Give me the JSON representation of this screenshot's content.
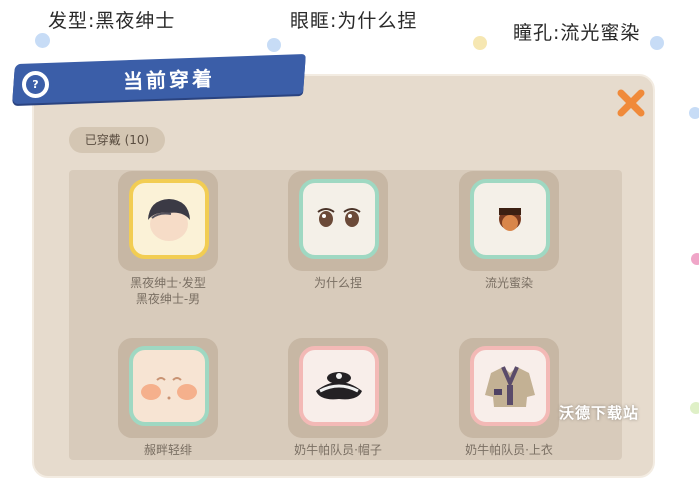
{
  "header_labels": {
    "hair": "发型:黑夜绅士",
    "eyes": "眼眶:为什么捏",
    "pupil": "瞳孔:流光蜜染"
  },
  "panel": {
    "title": "当前穿着",
    "worn_count_label": "已穿戴 (10)"
  },
  "items": [
    {
      "label": "黑夜绅士·发型\n黑夜绅士-男",
      "icon": "hair-head-icon",
      "frame_color": "#f2cd53"
    },
    {
      "label": "为什么捏",
      "icon": "eyes-icon",
      "frame_color": "#9fd8c2"
    },
    {
      "label": "流光蜜染",
      "icon": "pupil-icon",
      "frame_color": "#9fd8c2"
    },
    {
      "label": "赧畔轻绯",
      "icon": "blush-face-icon",
      "frame_color": "#9fd8c2"
    },
    {
      "label": "奶牛帕队员·帽子",
      "icon": "hat-icon",
      "frame_color": "#f3b9b6"
    },
    {
      "label": "奶牛帕队员·上衣",
      "icon": "jacket-icon",
      "frame_color": "#f3b9b6"
    }
  ],
  "watermark": "沃德下载站",
  "colors": {
    "panel_bg": "#e6dbcd",
    "banner": "#3b5ea8",
    "close": "#f08a3a"
  }
}
